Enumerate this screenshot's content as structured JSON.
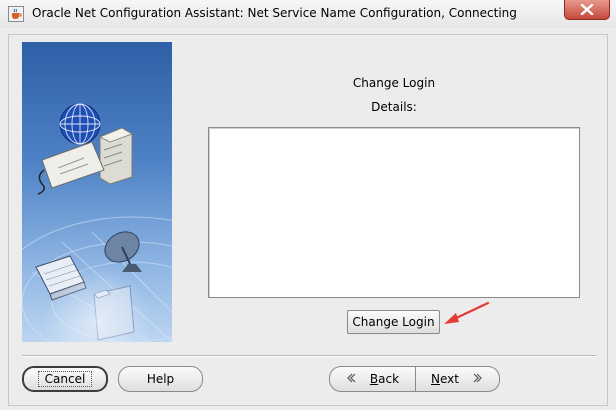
{
  "window": {
    "title": "Oracle Net Configuration Assistant: Net Service Name Configuration, Connecting"
  },
  "main": {
    "heading": "Change Login",
    "details_label": "Details:",
    "details_text": "",
    "change_login_button": "Change Login"
  },
  "footer": {
    "cancel": "Cancel",
    "help": "Help",
    "back_mnemonic": "B",
    "back_rest": "ack",
    "next_mnemonic": "N",
    "next_rest": "ext"
  },
  "colors": {
    "annotation_arrow": "#e53935",
    "close_button": "#c6493b",
    "side_panel_top": "#2f5fa6"
  },
  "icons": {
    "app": "java-cup-icon",
    "close": "close-icon",
    "back": "chevron-left-icon",
    "next": "chevron-right-icon"
  }
}
